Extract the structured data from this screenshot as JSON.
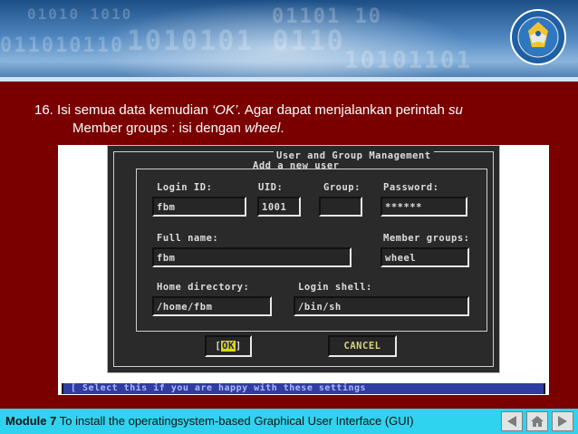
{
  "slide": {
    "instruction_number": "16.",
    "instruction_line1_a": "Isi semua data kemudian ",
    "instruction_line1_ok": "‘OK’.",
    "instruction_line1_b": " Agar dapat menjalankan perintah ",
    "instruction_line1_su": "su",
    "instruction_line2_a": "Member groups : isi dengan ",
    "instruction_line2_wheel": "wheel",
    "instruction_line2_end": "."
  },
  "terminal": {
    "dialog_title": "User and Group Management",
    "dialog_subtitle": "Add a new user",
    "labels": {
      "login_id": "Login ID:",
      "uid": "UID:",
      "group": "Group:",
      "password": "Password:",
      "full_name": "Full name:",
      "member_groups": "Member groups:",
      "home_directory": "Home directory:",
      "login_shell": "Login shell:"
    },
    "values": {
      "login_id": "fbm",
      "uid": "1001",
      "group": "",
      "password": "******",
      "full_name": "fbm",
      "member_groups": "wheel",
      "home_directory": "/home/fbm",
      "login_shell": "/bin/sh"
    },
    "buttons": {
      "ok_open": "[",
      "ok_label": "OK",
      "ok_close": "]",
      "cancel_label": "CANCEL"
    },
    "status_text": "[ Select this if you are happy with these settings"
  },
  "footer": {
    "module_label": "Module 7",
    "module_text": " To install the operatingsystem-based Graphical User Interface (GUI)"
  },
  "icons": {
    "logo": "ministry-emblem-icon",
    "prev": "arrow-left-icon",
    "home": "home-icon",
    "next": "arrow-right-icon"
  },
  "colors": {
    "slide_background": "#7a0000",
    "footer_background": "#2fd3ef",
    "terminal_background": "#2a2a2a",
    "ok_highlight": "#d8d800",
    "status_bar": "#2f3da0"
  }
}
